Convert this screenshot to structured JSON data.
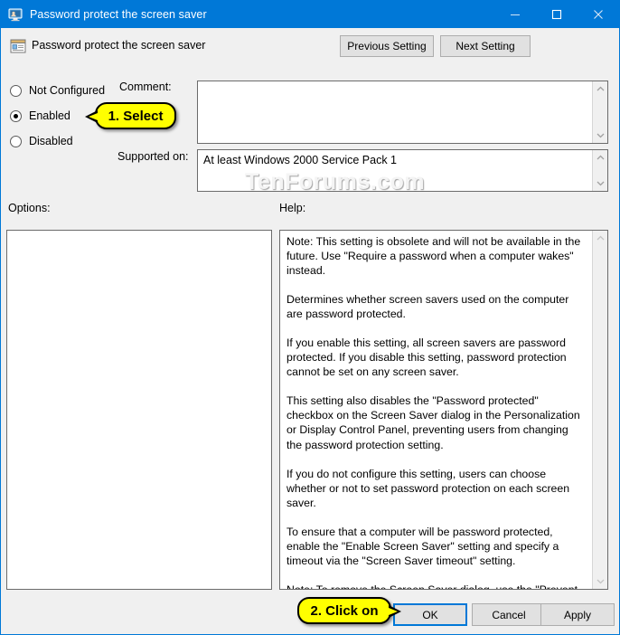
{
  "window": {
    "title": "Password protect the screen saver",
    "title_icon": "screen-saver-policy-icon",
    "minimize_label": "Minimize",
    "maximize_label": "Maximize",
    "close_label": "Close",
    "accent_color": "#0078d7"
  },
  "header": {
    "setting_icon": "policy-setting-icon",
    "setting_title": "Password protect the screen saver",
    "previous_button": "Previous Setting",
    "next_button": "Next Setting"
  },
  "state": {
    "options": [
      {
        "id": "not-configured",
        "label": "Not Configured",
        "selected": false
      },
      {
        "id": "enabled",
        "label": "Enabled",
        "selected": true
      },
      {
        "id": "disabled",
        "label": "Disabled",
        "selected": false
      }
    ]
  },
  "comment": {
    "label": "Comment:",
    "value": "",
    "placeholder": ""
  },
  "supported": {
    "label": "Supported on:",
    "value": "At least Windows 2000 Service Pack 1"
  },
  "options_panel": {
    "label": "Options:",
    "value": ""
  },
  "help_panel": {
    "label": "Help:",
    "paragraphs": [
      "Note: This setting is obsolete and will not be available in the future. Use \"Require a password when a computer wakes\" instead.",
      "Determines whether screen savers used on the computer are password protected.",
      "If you enable this setting, all screen savers are password protected. If you disable this setting, password protection cannot be set on any screen saver.",
      "This setting also disables the \"Password protected\" checkbox on the Screen Saver dialog in the Personalization or Display Control Panel, preventing users from changing the password protection setting.",
      "If you do not configure this setting, users can choose whether or not to set password protection on each screen saver.",
      "To ensure that a computer will be password protected, enable the \"Enable Screen Saver\" setting and specify a timeout via the \"Screen Saver timeout\" setting.",
      "Note: To remove the Screen Saver dialog, use the \"Prevent changing Screen Saver\" setting."
    ]
  },
  "footer": {
    "ok": "OK",
    "cancel": "Cancel",
    "apply": "Apply"
  },
  "callouts": {
    "step1": "1. Select",
    "step2": "2. Click on"
  },
  "watermark": {
    "text": "TenForums.com"
  }
}
